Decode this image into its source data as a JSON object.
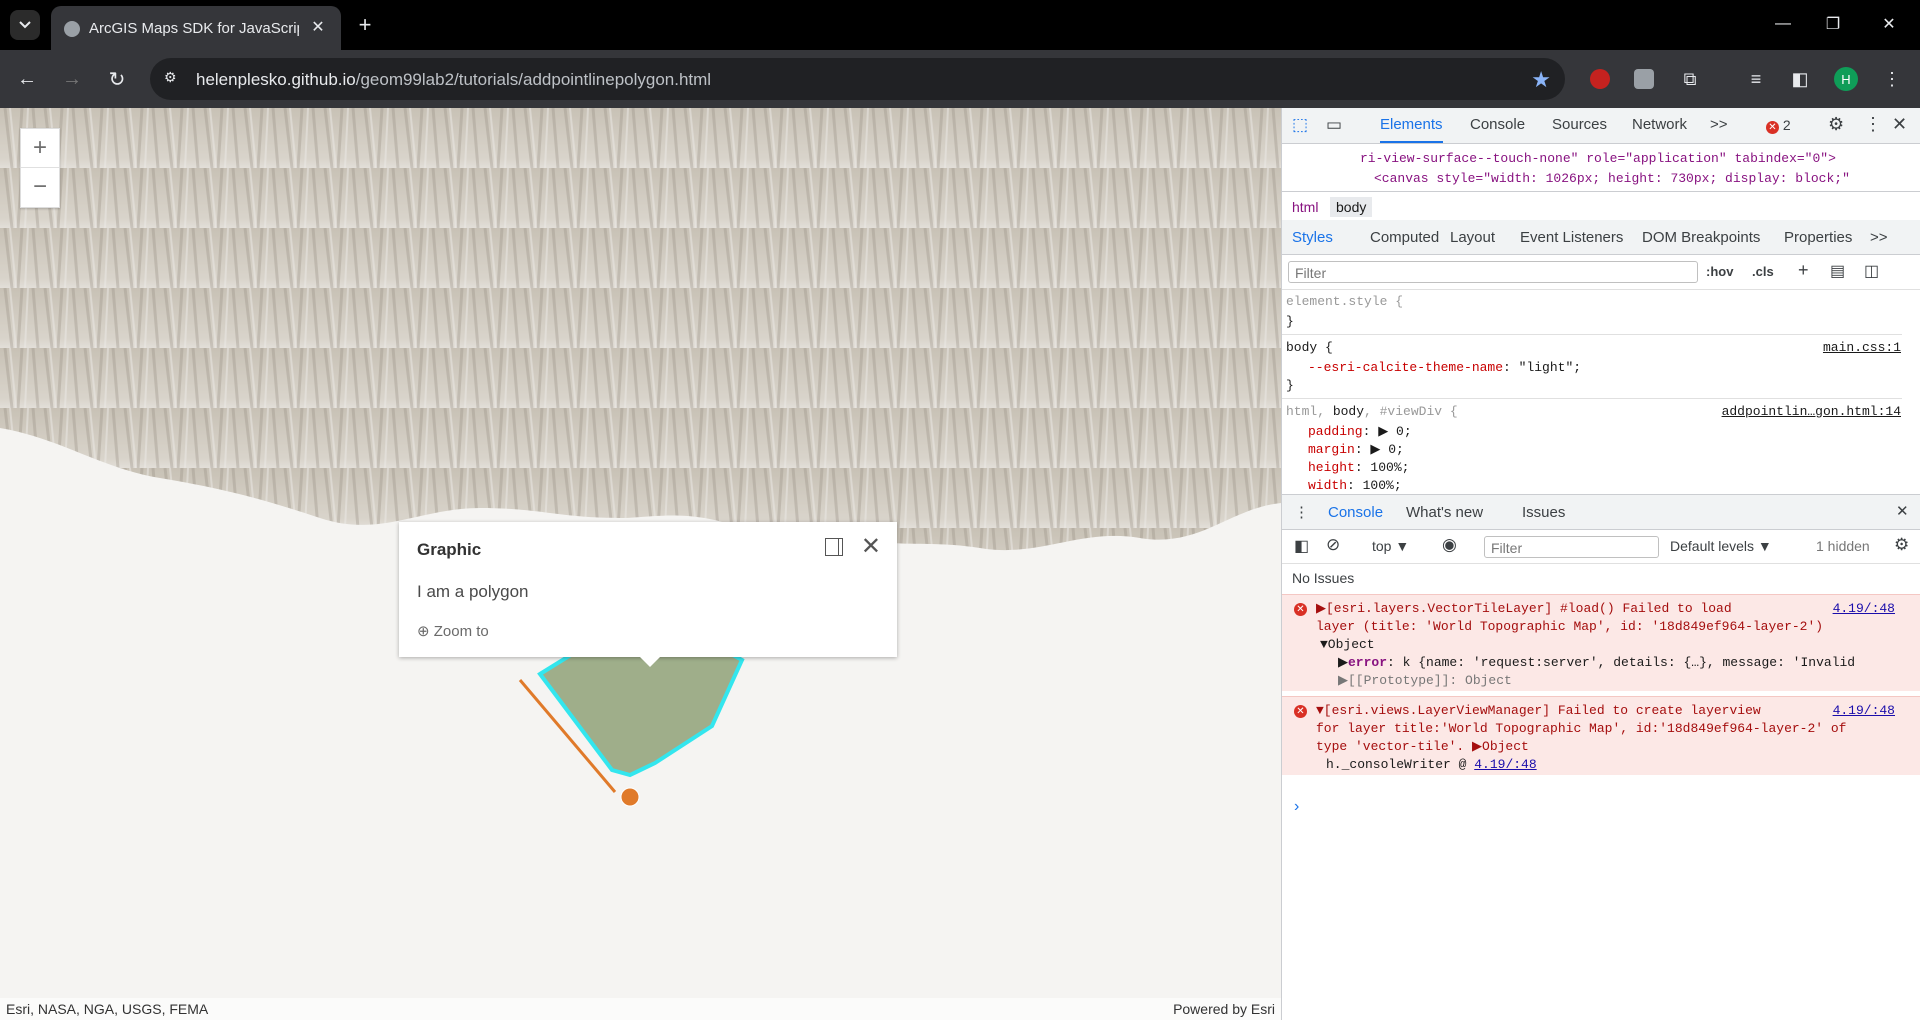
{
  "browser": {
    "tab_title": "ArcGIS Maps SDK for JavaScript",
    "new_tab": "+",
    "url_host": "helenplesko.github.io",
    "url_path": "/geom99lab2/tutorials/addpointlinepolygon.html",
    "profile_initial": "H"
  },
  "map": {
    "zoom_in": "+",
    "zoom_out": "−",
    "popup": {
      "title": "Graphic",
      "body": "I am a polygon",
      "zoom_to": "Zoom to"
    },
    "attribution_left": "Esri, NASA, NGA, USGS, FEMA",
    "attribution_right": "Powered by Esri",
    "colors": {
      "polygon_fill": "#9aaa84",
      "polygon_outline": "#33e6ee",
      "line": "#e07a2a",
      "point": "#e07a2a"
    }
  },
  "devtools": {
    "tabs": [
      "Elements",
      "Console",
      "Sources",
      "Network"
    ],
    "more": ">>",
    "error_count": "2",
    "dom_lines": [
      "ri-view-surface--touch-none\" role=\"application\" tabindex=\"0\">",
      "<canvas style=\"width: 1026px; height: 730px; display: block;\""
    ],
    "breadcrumbs": [
      "html",
      "body"
    ],
    "style_tabs": [
      "Styles",
      "Computed",
      "Layout",
      "Event Listeners",
      "DOM Breakpoints",
      "Properties"
    ],
    "filter_placeholder": "Filter",
    "hov": ":hov",
    "cls": ".cls",
    "rules": {
      "element_style": "element.style {",
      "close": "}",
      "body_selector": "body {",
      "body_source": "main.css:1",
      "body_prop": "--esri-calcite-theme-name",
      "body_val": "\"light\";",
      "html_selector_a": "html, ",
      "html_selector_b": "body",
      "html_selector_c": ", #viewDiv {",
      "html_source": "addpointlin…gon.html:14",
      "props": [
        {
          "name": "padding",
          "value": "▶ 0;"
        },
        {
          "name": "margin",
          "value": "▶ 0;"
        },
        {
          "name": "height",
          "value": "100%;"
        },
        {
          "name": "width",
          "value": "100%;"
        }
      ]
    },
    "drawer_tabs": [
      "Console",
      "What's new",
      "Issues"
    ],
    "console": {
      "context": "top",
      "filter_placeholder": "Filter",
      "levels": "Default levels",
      "hidden": "1 hidden",
      "no_issues": "No Issues",
      "error1_line1": "▶[esri.layers.VectorTileLayer] #load() Failed to load",
      "error1_line2": "layer (title: 'World Topographic Map', id: '18d849ef964-layer-2')",
      "error1_source": "4.19/:48",
      "error1_object": "▼Object",
      "error1_error_key": "error",
      "error1_error_val": ": k {name: 'request:server', details: {…}, message: 'Invalid",
      "error1_proto": "▶[[Prototype]]: Object",
      "error2_line1": "▼[esri.views.LayerViewManager] Failed to create layerview",
      "error2_line2": "for layer title:'World Topographic Map', id:'18d849ef964-layer-2' of",
      "error2_line3": "type 'vector-tile'.  ▶Object",
      "error2_source": "4.19/:48",
      "error2_trace": "h._consoleWriter @ ",
      "error2_trace_link": "4.19/:48",
      "prompt": "›"
    }
  }
}
